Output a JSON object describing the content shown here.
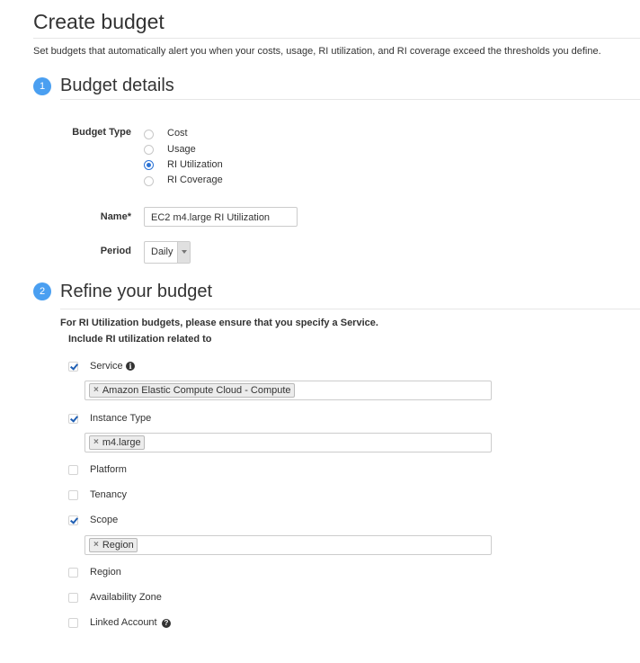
{
  "page": {
    "title": "Create budget",
    "intro": "Set budgets that automatically alert you when your costs, usage, RI utilization, and RI coverage exceed the thresholds you define."
  },
  "budget_details": {
    "step": "1",
    "title": "Budget details",
    "budget_type": {
      "label": "Budget Type",
      "options": [
        "Cost",
        "Usage",
        "RI Utilization",
        "RI Coverage"
      ],
      "selected": "RI Utilization"
    },
    "name": {
      "label": "Name*",
      "value": "EC2 m4.large RI Utilization"
    },
    "period": {
      "label": "Period",
      "value": "Daily"
    }
  },
  "refine": {
    "step": "2",
    "title": "Refine your budget",
    "note": "For RI Utilization budgets, please ensure that you specify a Service.",
    "include_label": "Include RI utilization related to",
    "filters": [
      {
        "label": "Service",
        "checked": true,
        "icon": "info-icon",
        "tags": [
          "Amazon Elastic Compute Cloud - Compute"
        ]
      },
      {
        "label": "Instance Type",
        "checked": true,
        "tags": [
          "m4.large"
        ]
      },
      {
        "label": "Platform",
        "checked": false
      },
      {
        "label": "Tenancy",
        "checked": false
      },
      {
        "label": "Scope",
        "checked": true,
        "tags": [
          "Region"
        ]
      },
      {
        "label": "Region",
        "checked": false
      },
      {
        "label": "Availability Zone",
        "checked": false
      },
      {
        "label": "Linked Account",
        "checked": false,
        "icon": "help-icon"
      }
    ],
    "tag_remove_glyph": "×",
    "info_glyph": "i",
    "help_glyph": "?"
  },
  "colors": {
    "step_circle": "#4a9ff1",
    "radio_selected": "#2b73d6",
    "check_mark": "#1f5fb4"
  }
}
